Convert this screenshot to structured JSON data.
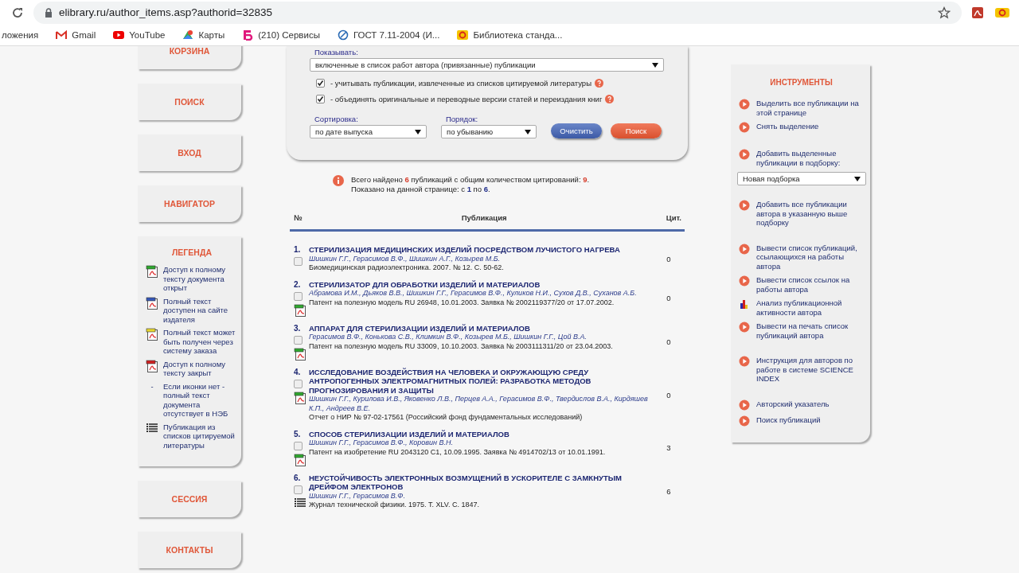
{
  "browser": {
    "url": "elibrary.ru/author_items.asp?authorid=32835",
    "bookmarks": [
      {
        "kind": "apps",
        "label": "ложения"
      },
      {
        "kind": "mail",
        "label": "Gmail"
      },
      {
        "kind": "video",
        "label": "YouTube"
      },
      {
        "kind": "map",
        "label": "Карты"
      },
      {
        "kind": "letter",
        "label": "(210) Сервисы"
      },
      {
        "kind": "link",
        "label": "ГОСТ 7.11-2004 (И..."
      },
      {
        "kind": "library",
        "label": "Библиотека станда..."
      }
    ]
  },
  "nav": [
    {
      "label": "КОРЗИНА"
    },
    {
      "label": "ПОИСК"
    },
    {
      "label": "ВХОД"
    },
    {
      "label": "НАВИГАТОР"
    },
    {
      "kind": "legend"
    },
    {
      "label": "СЕССИЯ"
    },
    {
      "label": "КОНТАКТЫ"
    }
  ],
  "legend": {
    "title": "ЛЕГЕНДА",
    "items": [
      {
        "kind": "open",
        "text": "Доступ к полному тексту документа открыт"
      },
      {
        "kind": "publisher",
        "text": "Полный текст доступен на сайте издателя"
      },
      {
        "kind": "order",
        "text": "Полный текст может быть получен через систему заказа"
      },
      {
        "kind": "closed",
        "text": "Доступ к полному тексту закрыт"
      },
      {
        "kind": "dash",
        "mark": "-",
        "text": "Если иконки нет - полный текст документа отсутствует в НЭБ"
      },
      {
        "kind": "list",
        "text": "Публикация из списков цитируемой литературы"
      }
    ]
  },
  "form": {
    "show_label": "Показывать:",
    "show_value": "включенные в список работ автора (привязанные) публикации",
    "options": [
      {
        "label": "- учитывать публикации, извлеченные из списков цитируемой литературы",
        "checked": true
      },
      {
        "label": "- объединять оригинальные и переводные версии статей и переиздания книг",
        "checked": true
      }
    ],
    "sort_label": "Сортировка:",
    "sort_value": "по дате выпуска",
    "order_label": "Порядок:",
    "order_value": "по убыванию",
    "buttons": [
      {
        "kind": "clear",
        "label": "Очистить"
      },
      {
        "kind": "search",
        "label": "Поиск"
      }
    ]
  },
  "summary": [
    "Всего найдено **6** публикаций с общим количеством цитирований: **9**.",
    "Показано на данной странице: с **1** по **6**."
  ],
  "table": {
    "columns": [
      "№",
      "Публикация",
      "Цит."
    ],
    "rows": [
      {
        "number": "1.",
        "title": "СТЕРИЛИЗАЦИЯ МЕДИЦИНСКИХ ИЗДЕЛИЙ ПОСРЕДСТВОМ ЛУЧИСТОГО НАГРЕВА",
        "authors": "Шишкин Г.Г., Герасимов В.Ф., Шишкин А.Г., Козырев М.Б.",
        "source": "Биомедицинская радиоэлектроника. 2007. № 12. С. 50-62.",
        "cited": "0",
        "selected": false,
        "kind": "plain"
      },
      {
        "number": "2.",
        "title": "СТЕРИЛИЗАТОР ДЛЯ ОБРАБОТКИ ИЗДЕЛИЙ И МАТЕРИАЛОВ",
        "authors": "Абрамова И.М., Дьяков В.В., Шишкин Г.Г., Герасимов В.Ф., Куликов Н.И., Сухов Д.В., Суханов А.Б.",
        "source": "Патент на полезную модель RU 26948, 10.01.2003. Заявка № 2002119377/20 от 17.07.2002.",
        "cited": "0",
        "selected": false,
        "kind": "fulltext"
      },
      {
        "number": "3.",
        "title": "АППАРАТ ДЛЯ СТЕРИЛИЗАЦИИ ИЗДЕЛИЙ И МАТЕРИАЛОВ",
        "authors": "Герасимов В.Ф., Конькова С.В., Климкин В.Ф., Козырев М.Б., Шишкин Г.Г., Цой В.А.",
        "source": "Патент на полезную модель RU 33009, 10.10.2003. Заявка № 2003111311/20 от 23.04.2003.",
        "cited": "0",
        "selected": false,
        "kind": "fulltext"
      },
      {
        "number": "4.",
        "title": "ИССЛЕДОВАНИЕ ВОЗДЕЙСТВИЯ НА ЧЕЛОВЕКА И ОКРУЖАЮЩУЮ СРЕДУ АНТРОПОГЕННЫХ ЭЛЕКТРОМАГНИТНЫХ ПОЛЕЙ: РАЗРАБОТКА МЕТОДОВ ПРОГНОЗИРОВАНИЯ И ЗАЩИТЫ",
        "authors": "Шишкин Г.Г., Курилова И.В., Яковенко Л.В., Перцев А.А., Герасимов В.Ф., Твердислов В.А., Кирдяшев К.П., Андреев В.Е.",
        "source": "Отчет о НИР  № 97-02-17561 (Российский фонд фундаментальных исследований)",
        "cited": "0",
        "selected": false,
        "kind": "fulltext"
      },
      {
        "number": "5.",
        "title": "СПОСОБ СТЕРИЛИЗАЦИИ ИЗДЕЛИЙ И МАТЕРИАЛОВ",
        "authors": "Шишкин Г.Г., Герасимов В.Ф., Коровин В.Н.",
        "source": "Патент на изобретение RU 2043120 C1, 10.09.1995. Заявка № 4914702/13 от 10.01.1991.",
        "cited": "3",
        "selected": false,
        "kind": "fulltext"
      },
      {
        "number": "6.",
        "title": "НЕУСТОЙЧИВОСТЬ ЭЛЕКТРОННЫХ ВОЗМУЩЕНИЙ В УСКОРИТЕЛЕ С ЗАМКНУТЫМ ДРЕЙФОМ ЭЛЕКТРОНОВ",
        "authors": "Шишкин Г.Г., Герасимов В.Ф.",
        "source": "Журнал технической физики. 1975. Т. XLV. С. 1847.",
        "cited": "6",
        "selected": false,
        "kind": "citation"
      }
    ]
  },
  "tools": {
    "title": "ИНСТРУМЕНТЫ",
    "groups": [
      [
        {
          "kind": "action",
          "text": "Выделить все публикации на этой странице"
        },
        {
          "kind": "action",
          "text": "Снять выделение"
        }
      ],
      [
        {
          "kind": "action",
          "text": "Добавить выделенные публикации в подборку:"
        },
        {
          "kind": "select",
          "text": "Новая подборка"
        },
        {
          "kind": "action",
          "text": "Добавить все публикации автора в указанную выше подборку"
        }
      ],
      [
        {
          "kind": "action",
          "text": "Вывести список публикаций, ссылающихся на работы автора"
        },
        {
          "kind": "action",
          "text": "Вывести список ссылок на работы автора"
        },
        {
          "kind": "chart",
          "text": "Анализ публикационной активности автора"
        },
        {
          "kind": "action",
          "text": "Вывести на печать список публикаций автора"
        }
      ],
      [
        {
          "kind": "action",
          "text": "Инструкция для авторов по работе в системе SCIENCE INDEX"
        }
      ],
      [
        {
          "kind": "action",
          "text": "Авторский указатель"
        },
        {
          "kind": "action",
          "text": "Поиск публикаций"
        }
      ]
    ]
  }
}
